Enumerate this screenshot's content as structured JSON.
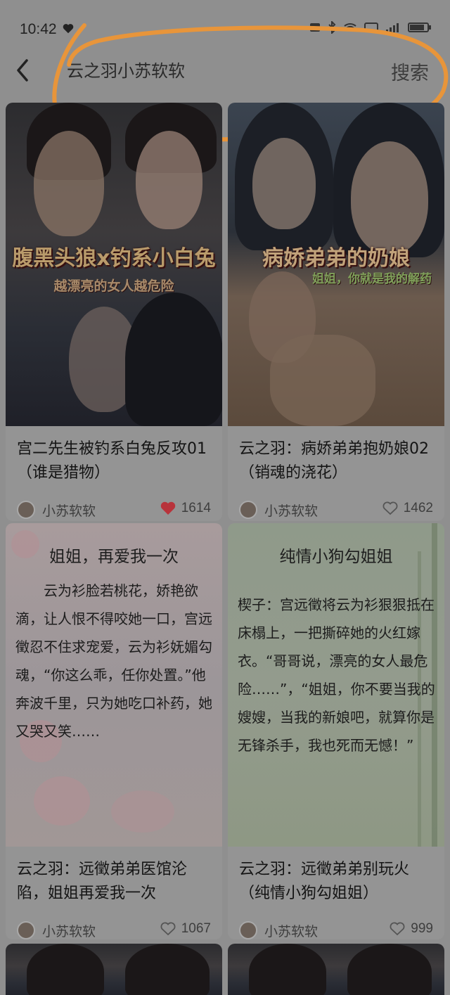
{
  "status": {
    "time": "10:42"
  },
  "header": {
    "search_value": "云之羽小苏软软",
    "search_button": "搜索"
  },
  "cards": [
    {
      "overlay_title": "腹黑头狼x钓系小白兔",
      "overlay_sub": "越漂亮的女人越危险",
      "title": "宫二先生被钓系白兔反攻01（谁是猎物）",
      "author": "小苏软软",
      "likes": "1614",
      "liked": true
    },
    {
      "overlay_title": "病娇弟弟的奶娘",
      "overlay_sub": "姐姐，你就是我的解药",
      "title": "云之羽：病娇弟弟抱奶娘02（销魂的浇花）",
      "author": "小苏软软",
      "likes": "1462",
      "liked": false
    },
    {
      "poem_title": "姐姐，再爱我一次",
      "poem": "云为衫脸若桃花，娇艳欲滴，让人恨不得咬她一口，宫远徵忍不住求宠爱，云为衫妩媚勾魂，“你这么乖，任你处置。”他奔波千里，只为她吃口补药，她又哭又笑……",
      "title": "云之羽：远徵弟弟医馆沦陷，姐姐再爱我一次",
      "author": "小苏软软",
      "likes": "1067",
      "liked": false
    },
    {
      "poem_title": "纯情小狗勾姐姐",
      "poem": "楔子：宫远徵将云为衫狠狠抵在床榻上，一把撕碎她的火红嫁衣。“哥哥说，漂亮的女人最危险……”，“姐姐，你不要当我的嫂嫂，当我的新娘吧，就算你是无锋杀手，我也死而无憾！”",
      "title": "云之羽：远徵弟弟别玩火（纯情小狗勾姐姐）",
      "author": "小苏软软",
      "likes": "999",
      "liked": false
    }
  ]
}
